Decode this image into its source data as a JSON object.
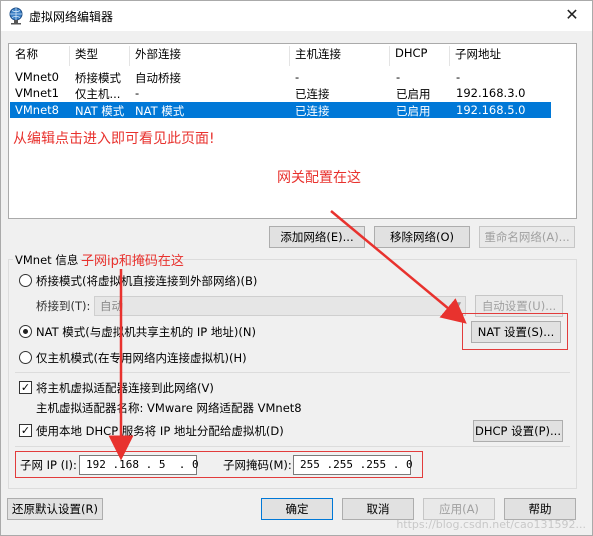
{
  "window": {
    "title": "虚拟网络编辑器",
    "close_glyph": "✕"
  },
  "netlist": {
    "headers": [
      "名称",
      "类型",
      "外部连接",
      "主机连接",
      "DHCP",
      "子网地址"
    ],
    "rows": [
      {
        "name": "VMnet0",
        "type": "桥接模式",
        "external": "自动桥接",
        "host": "-",
        "dhcp": "-",
        "subnet": "-"
      },
      {
        "name": "VMnet1",
        "type": "仅主机...",
        "external": "-",
        "host": "已连接",
        "dhcp": "已启用",
        "subnet": "192.168.3.0"
      },
      {
        "name": "VMnet8",
        "type": "NAT 模式",
        "external": "NAT 模式",
        "host": "已连接",
        "dhcp": "已启用",
        "subnet": "192.168.5.0"
      }
    ],
    "selected_row": 2
  },
  "list_buttons": {
    "add": "添加网络(E)...",
    "remove": "移除网络(O)",
    "rename": "重命名网络(A)..."
  },
  "vmnet_info": {
    "group_label": "VMnet 信息",
    "bridge_radio": "桥接模式(将虚拟机直接连接到外部网络)(B)",
    "bridge_to_label": "桥接到(T):",
    "bridge_to_value": "自动",
    "auto_settings": "自动设置(U)...",
    "nat_radio": "NAT 模式(与虚拟机共享主机的 IP 地址)(N)",
    "nat_settings": "NAT 设置(S)...",
    "hostonly_radio": "仅主机模式(在专用网络内连接虚拟机)(H)",
    "connect_adapter": "将主机虚拟适配器连接到此网络(V)",
    "adapter_name": "主机虚拟适配器名称: VMware 网络适配器 VMnet8",
    "use_dhcp": "使用本地 DHCP 服务将 IP 地址分配给虚拟机(D)",
    "dhcp_settings": "DHCP 设置(P)...",
    "subnet_ip_label": "子网 IP (I):",
    "subnet_ip_value": "192 .168 . 5  . 0",
    "subnet_mask_label": "子网掩码(M):",
    "subnet_mask_value": "255 .255 .255 . 0"
  },
  "bottom_buttons": {
    "restore": "还原默认设置(R)",
    "ok": "确定",
    "cancel": "取消",
    "apply": "应用(A)",
    "help": "帮助"
  },
  "annotations": {
    "note_main": "从编辑点击进入即可看见此页面!",
    "note_gateway": "网关配置在这",
    "note_subnet": "子网ip和掩码在这"
  },
  "watermark": "https://blog.csdn.net/cao131592..."
}
